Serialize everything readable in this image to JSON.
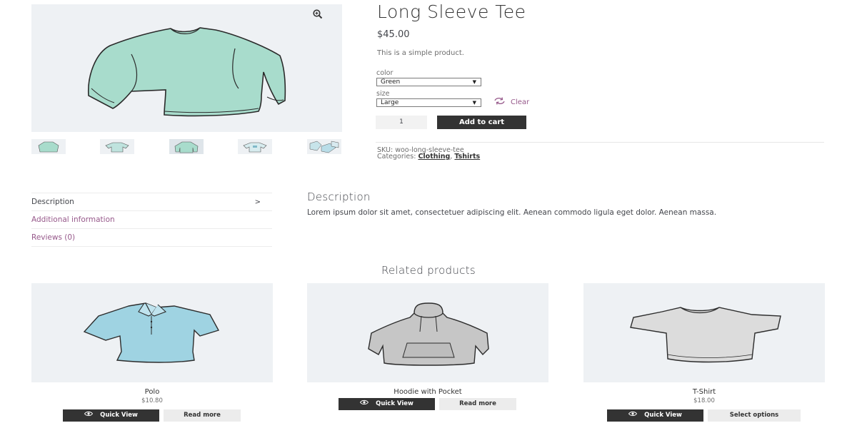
{
  "product": {
    "title": "Long Sleeve Tee",
    "price": "$45.00",
    "short_description": "This is a simple product.",
    "attributes": [
      {
        "label": "color",
        "selected": "Green"
      },
      {
        "label": "size",
        "selected": "Large"
      }
    ],
    "clear_label": "Clear",
    "quantity": "1",
    "add_to_cart_label": "Add to cart",
    "sku_label": "SKU:",
    "sku": "woo-long-sleeve-tee",
    "categories_label": "Categories:",
    "categories": [
      "Clothing",
      "Tshirts"
    ],
    "category_separator": ","
  },
  "tabs": [
    {
      "label": "Description",
      "active": true
    },
    {
      "label": "Additional information",
      "active": false
    },
    {
      "label": "Reviews (0)",
      "active": false
    }
  ],
  "description_panel": {
    "title": "Description",
    "body": "Lorem ipsum dolor sit amet, consectetuer adipiscing elit. Aenean commodo ligula eget dolor. Aenean massa."
  },
  "related": {
    "title": "Related products",
    "items": [
      {
        "name": "Polo",
        "price": "$10.80",
        "quick_view_label": "Quick View",
        "action_label": "Read more"
      },
      {
        "name": "Hoodie with Pocket",
        "price": "",
        "quick_view_label": "Quick View",
        "action_label": "Read more"
      },
      {
        "name": "T-Shirt",
        "price": "$18.00",
        "quick_view_label": "Quick View",
        "action_label": "Select options"
      }
    ]
  },
  "colors": {
    "accent": "#96588a",
    "dark_button": "#333333",
    "image_bg": "#eef1f4"
  },
  "icons": {
    "zoom": "zoom-in-icon",
    "clear": "refresh-icon",
    "quick_view": "eye-icon",
    "tab_chevron": "chevron-right-icon"
  }
}
